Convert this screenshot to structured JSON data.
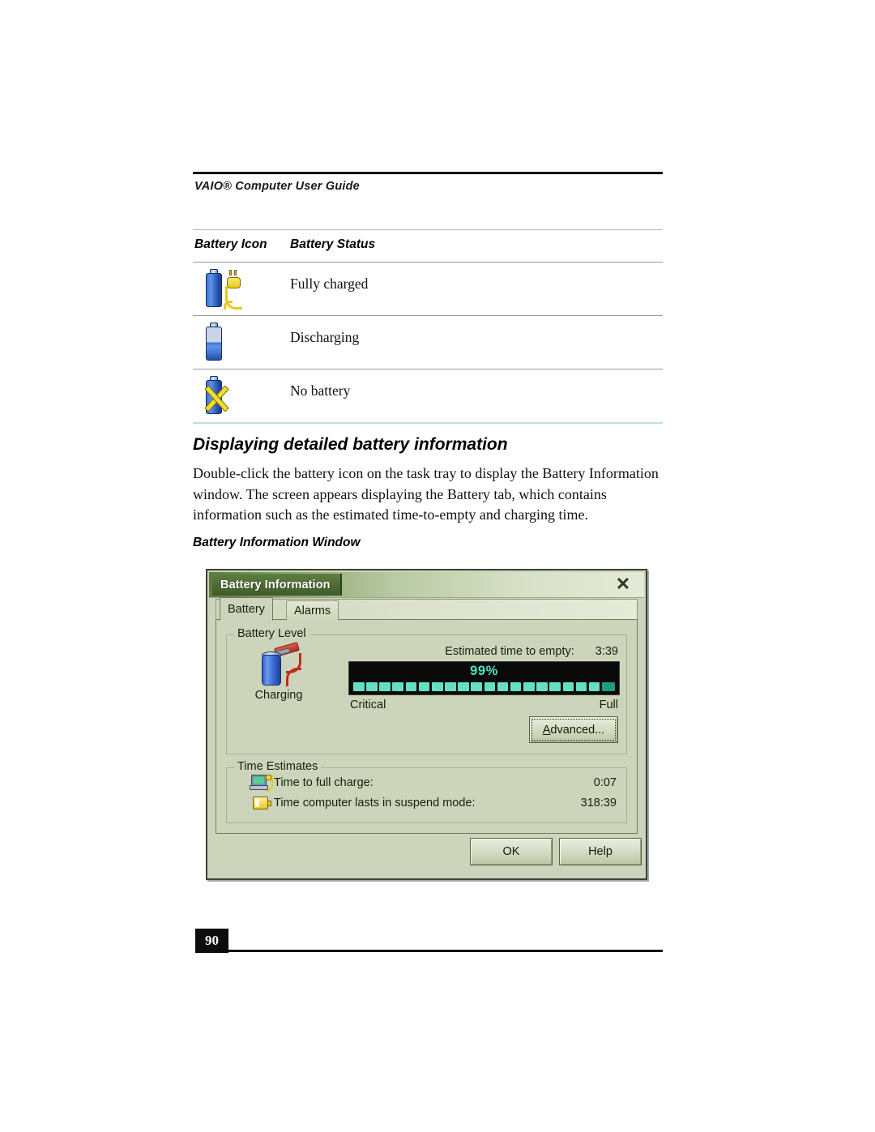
{
  "page": {
    "running_header": "VAIO® Computer User Guide",
    "page_number": "90"
  },
  "status_table": {
    "columns": [
      "Battery Icon",
      "Battery Status"
    ],
    "rows": [
      {
        "icon": "battery-plugged-icon",
        "status": "Fully charged"
      },
      {
        "icon": "battery-half-icon",
        "status": "Discharging"
      },
      {
        "icon": "battery-x-icon",
        "status": "No battery"
      }
    ]
  },
  "section": {
    "heading": "Displaying detailed battery information",
    "paragraph": "Double-click the battery icon on the task tray to display the Battery Information window. The screen appears displaying the Battery tab, which contains information such as the estimated time-to-empty and charging time.",
    "figure_caption": "Battery Information Window"
  },
  "dialog": {
    "title": "Battery Information",
    "close_icon": "close-icon",
    "tabs": [
      {
        "label": "Battery",
        "active": true
      },
      {
        "label": "Alarms",
        "active": false
      }
    ],
    "battery_level": {
      "legend": "Battery Level",
      "charging_icon": "battery-charging-clamp-icon",
      "charging_label": "Charging",
      "estimated_label": "Estimated time to empty:",
      "estimated_value": "3:39",
      "percent_text": "99%",
      "percent_value": 99,
      "segment_count": 20,
      "scale_low": "Critical",
      "scale_high": "Full",
      "advanced_button": "Advanced...",
      "advanced_accel": "A",
      "meter_fill_color": "#63e0c0",
      "meter_tail_color": "#1e9e7e",
      "meter_bg_color": "#0a0a0a"
    },
    "time_estimates": {
      "legend": "Time Estimates",
      "rows": [
        {
          "icon": "laptop-plugged-icon",
          "label": "Time to full charge:",
          "value": "0:07"
        },
        {
          "icon": "battery-suspend-icon",
          "label": "Time computer lasts in suspend mode:",
          "value": "318:39"
        }
      ]
    },
    "buttons": [
      {
        "label": "OK"
      },
      {
        "label": "Help"
      }
    ],
    "colors": {
      "window_face": "#cdd4bc",
      "titlebar_dark": "#5c7a3f",
      "titlebar_light": "#e4ead8"
    }
  }
}
